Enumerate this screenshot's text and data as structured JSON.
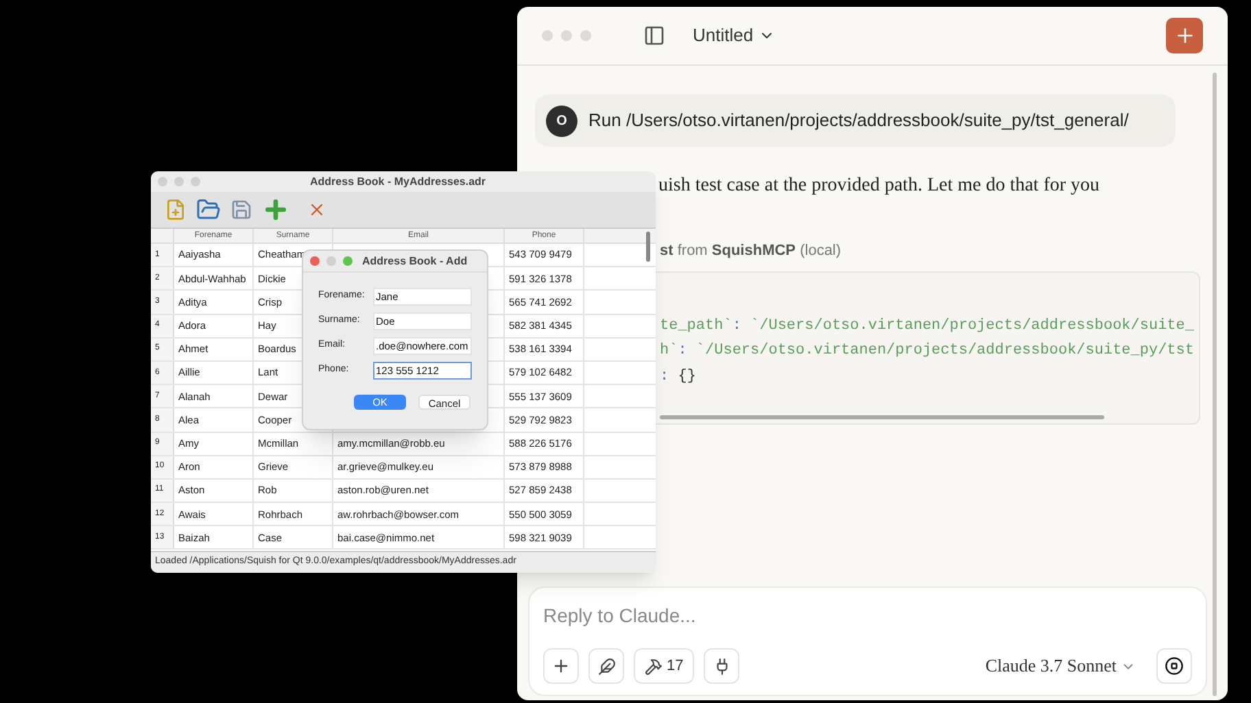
{
  "claude_window": {
    "title": "Untitled",
    "user_message": {
      "avatar": "O",
      "text": "Run /Users/otso.virtanen/projects/addressbook/suite_py/tst_general/"
    },
    "assistant_text": "uish test case at the provided path. Let me do that for you",
    "tool_call": {
      "name": "st",
      "source_label": "from",
      "server": "SquishMCP",
      "location": "(local)"
    },
    "code_lines": [
      {
        "key": "te_path`",
        "separator": ":",
        "value": "`/Users/otso.virtanen/projects/addressbook/suite_",
        "kind": "string"
      },
      {
        "key": "h`",
        "separator": ":",
        "value": "`/Users/otso.virtanen/projects/addressbook/suite_py/tst",
        "kind": "string"
      },
      {
        "separator": ":",
        "value": "{}",
        "kind": "plain"
      }
    ],
    "composer": {
      "placeholder": "Reply to Claude...",
      "tool_count": "17",
      "model": "Claude 3.7 Sonnet"
    }
  },
  "address_book": {
    "title": "Address Book - MyAddresses.adr",
    "columns": [
      "Forename",
      "Surname",
      "Email",
      "Phone"
    ],
    "rows": [
      {
        "number": "1",
        "forename": "Aaiyasha",
        "surname": "Cheatham",
        "phone": "543 709 9479"
      },
      {
        "number": "2",
        "forename": "Abdul-Wahhab",
        "surname": "Dickie",
        "phone": "591 326 1378"
      },
      {
        "number": "3",
        "forename": "Aditya",
        "surname": "Crisp",
        "phone": "565 741 2692"
      },
      {
        "number": "4",
        "forename": "Adora",
        "surname": "Hay",
        "phone": "582 381 4345"
      },
      {
        "number": "5",
        "forename": "Ahmet",
        "surname": "Boardus",
        "phone": "538 161 3394"
      },
      {
        "number": "6",
        "forename": "Aillie",
        "surname": "Lant",
        "phone": "579 102 6482"
      },
      {
        "number": "7",
        "forename": "Alanah",
        "surname": "Dewar",
        "phone": "555 137 3609"
      },
      {
        "number": "8",
        "forename": "Alea",
        "surname": "Cooper",
        "phone": "529 792 9823"
      },
      {
        "number": "9",
        "forename": "Amy",
        "surname": "Mcmillan",
        "email": "amy.mcmillan@robb.eu",
        "phone": "588 226 5176"
      },
      {
        "number": "10",
        "forename": "Aron",
        "surname": "Grieve",
        "email": "ar.grieve@mulkey.eu",
        "phone": "573 879 8988"
      },
      {
        "number": "11",
        "forename": "Aston",
        "surname": "Rob",
        "email": "aston.rob@uren.net",
        "phone": "527 859 2438"
      },
      {
        "number": "12",
        "forename": "Awais",
        "surname": "Rohrbach",
        "email": "aw.rohrbach@bowser.com",
        "phone": "550 500 3059"
      },
      {
        "number": "13",
        "forename": "Baizah",
        "surname": "Case",
        "email": "bai.case@nimmo.net",
        "phone": "598 321 9039"
      }
    ],
    "status": "Loaded /Applications/Squish for Qt 9.0.0/examples/qt/addressbook/MyAddresses.adr"
  },
  "add_dialog": {
    "title": "Address Book - Add",
    "fields": [
      {
        "label": "Forename:",
        "value": "Jane",
        "focused": false
      },
      {
        "label": "Surname:",
        "value": "Doe",
        "focused": false
      },
      {
        "label": "Email:",
        "value": ".doe@nowhere.com",
        "focused": false
      },
      {
        "label": "Phone:",
        "value": "123 555 1212",
        "focused": true
      }
    ],
    "buttons": [
      {
        "label": "OK",
        "default": true
      },
      {
        "label": "Cancel",
        "default": false
      }
    ]
  }
}
